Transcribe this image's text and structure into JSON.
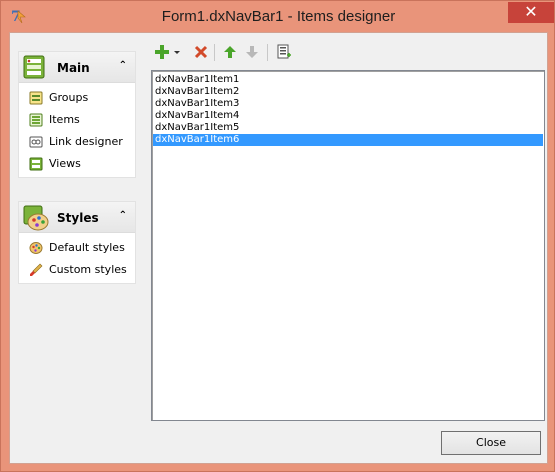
{
  "window": {
    "title": "Form1.dxNavBar1  - Items designer",
    "close_glyph": "✕"
  },
  "nav": {
    "groups": [
      {
        "caption": "Main",
        "icon": "main-group-icon",
        "items": [
          {
            "label": "Groups",
            "icon": "groups-icon"
          },
          {
            "label": "Items",
            "icon": "items-icon"
          },
          {
            "label": "Link designer",
            "icon": "link-designer-icon"
          },
          {
            "label": "Views",
            "icon": "views-icon"
          }
        ]
      },
      {
        "caption": "Styles",
        "icon": "styles-group-icon",
        "items": [
          {
            "label": "Default styles",
            "icon": "palette-icon"
          },
          {
            "label": "Custom styles",
            "icon": "brush-icon"
          }
        ]
      }
    ],
    "chevron": "⌃"
  },
  "toolbar": {
    "buttons": [
      "add-icon",
      "add-dropdown-icon",
      "delete-icon",
      "move-up-icon",
      "move-down-icon",
      "select-all-icon"
    ]
  },
  "list": {
    "items": [
      "dxNavBar1Item1",
      "dxNavBar1Item2",
      "dxNavBar1Item3",
      "dxNavBar1Item4",
      "dxNavBar1Item5",
      "dxNavBar1Item6"
    ],
    "selected_index": 5
  },
  "footer": {
    "close_label": "Close"
  },
  "colors": {
    "frame": "#e9947a",
    "selection": "#3399ff",
    "close_button": "#c7433a"
  }
}
